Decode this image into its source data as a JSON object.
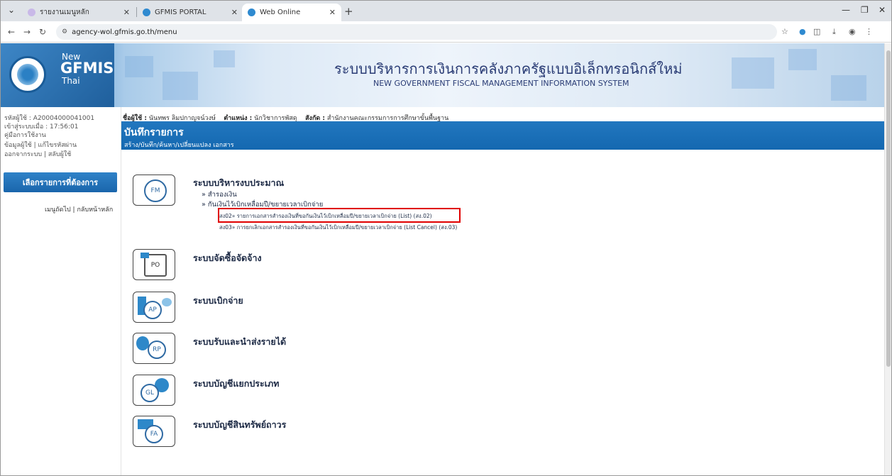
{
  "browser": {
    "tabs": [
      {
        "label": "รายงานเมนูหลัก"
      },
      {
        "label": "GFMIS PORTAL"
      },
      {
        "label": "Web Online"
      }
    ],
    "url": "agency-wol.gfmis.go.th/menu"
  },
  "colors": {
    "accent": "#1a6db5",
    "highlight": "#e00000",
    "heading": "#2a3c75"
  },
  "header": {
    "logo_new": "New",
    "logo_gfmis": "GFMIS",
    "logo_thai": "Thai",
    "title_th": "ระบบบริหารการเงินการคลังภาครัฐแบบอิเล็กทรอนิกส์ใหม่",
    "title_en": "NEW GOVERNMENT FISCAL MANAGEMENT INFORMATION SYSTEM"
  },
  "sidebar": {
    "user_code": "รหัสผู้ใช้ : A20004000041001",
    "login_time": "เข้าสู่ระบบเมื่อ : 17:56:01",
    "manual": "คู่มือการใช้งาน",
    "user_links": "ข้อมูลผู้ใช้ | แก้ไขรหัสผ่าน",
    "logout_links": "ออกจากระบบ | สลับผู้ใช้",
    "menu_button": "เลือกรายการที่ต้องการ",
    "nav_links": "เมนูถัดไป | กลับหน้าหลัก"
  },
  "userbar": {
    "name_label": "ชื่อผู้ใช้ :",
    "name_value": "นันทพร ลิมปกาญจน์วงษ์",
    "position_label": "ตำแหน่ง :",
    "position_value": "นักวิชาการพัสดุ",
    "org_label": "สังกัด :",
    "org_value": "สำนักงานคณะกรรมการการศึกษาขั้นพื้นฐาน"
  },
  "titlebar": {
    "title": "บันทึกรายการ",
    "subtitle": "สร้าง/บันทึก/ค้นหา/เปลี่ยนแปลง เอกสาร"
  },
  "modules": [
    {
      "icon": "FM",
      "title": "ระบบบริหารงบประมาณ"
    },
    {
      "icon": "PO",
      "title": "ระบบจัดซื้อจัดจ้าง"
    },
    {
      "icon": "AP",
      "title": "ระบบเบิกจ่าย"
    },
    {
      "icon": "RP",
      "title": "ระบบรับและนำส่งรายได้"
    },
    {
      "icon": "GL",
      "title": "ระบบบัญชีแยกประเภท"
    },
    {
      "icon": "FA",
      "title": "ระบบบัญชีสินทรัพย์ถาวร"
    }
  ],
  "fm_menu": {
    "item1": "» สำรองเงิน",
    "item2": "» กันเงินไว้เบิกเหลื่อมปี/ขยายเวลาเบิกจ่าย",
    "sub1": "สง02» รายการเอกสารสำรองเงินที่ขอกันเงินไว้เบิกเหลื่อมปี/ขยายเวลาเบิกจ่าย (List) (สง.02)",
    "sub2": "สง03» การยกเลิกเอกสารสำรองเงินที่ขอกันเงินไว้เบิกเหลื่อมปี/ขยายเวลาเบิกจ่าย (List Cancel) (สง.03)"
  }
}
